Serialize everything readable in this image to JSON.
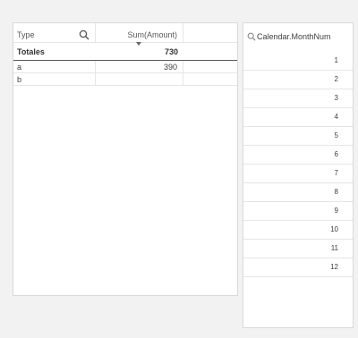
{
  "table": {
    "headers": {
      "type": "Type",
      "sum": "Sum(Amount)"
    },
    "totals": {
      "label": "Totales",
      "value": "730"
    },
    "rows": [
      {
        "type": "a",
        "value": "390"
      },
      {
        "type": "b",
        "value": ""
      }
    ]
  },
  "listbox": {
    "title": "Calendar.MonthNum",
    "items": [
      "1",
      "2",
      "3",
      "4",
      "5",
      "6",
      "7",
      "8",
      "9",
      "10",
      "11",
      "12"
    ]
  },
  "icons": {
    "header_search": "search-icon",
    "list_search": "search-icon",
    "sort": "sort-descending-icon"
  },
  "colors": {
    "background": "#f2f2f2",
    "panel": "#ffffff",
    "border": "#d9d9d9",
    "text": "#404040"
  }
}
